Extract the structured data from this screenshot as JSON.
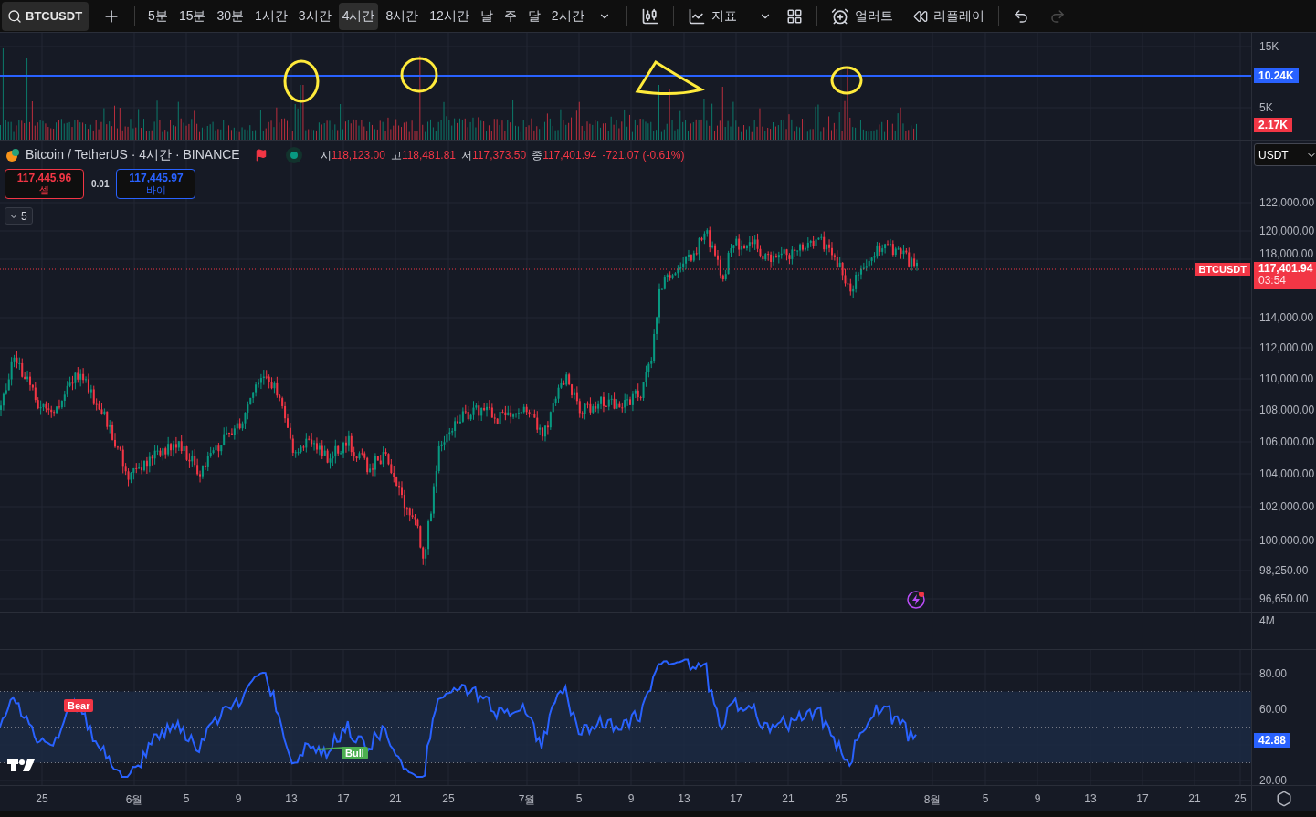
{
  "toolbar": {
    "symbol": "BTCUSDT",
    "intervals": [
      {
        "label": "5분",
        "selected": false
      },
      {
        "label": "15분",
        "selected": false
      },
      {
        "label": "30분",
        "selected": false
      },
      {
        "label": "1시간",
        "selected": false
      },
      {
        "label": "3시간",
        "selected": false
      },
      {
        "label": "4시간",
        "selected": true
      },
      {
        "label": "8시간",
        "selected": false
      },
      {
        "label": "12시간",
        "selected": false
      },
      {
        "label": "날",
        "selected": false
      },
      {
        "label": "주",
        "selected": false
      },
      {
        "label": "달",
        "selected": false
      },
      {
        "label": "2시간",
        "selected": false
      }
    ],
    "indicators_label": "지표",
    "alert_label": "얼러트",
    "replay_label": "리플레이",
    "redo_disabled": true
  },
  "volume_pane": {
    "axis": [
      "15K",
      "5K"
    ],
    "line_badge": "10.24K",
    "volume_badge": "2.17K"
  },
  "legend": {
    "title": "Bitcoin / TetherUS · 4시간 · BINANCE",
    "ohlc": [
      {
        "key": "시",
        "value": "118,123.00"
      },
      {
        "key": "고",
        "value": "118,481.81"
      },
      {
        "key": "저",
        "value": "117,373.50"
      },
      {
        "key": "종",
        "value": "117,401.94"
      }
    ],
    "change": "-721.07 (-0.61%)"
  },
  "trade": {
    "sell_price": "117,445.96",
    "sell_label": "셀",
    "spread": "0.01",
    "buy_price": "117,445.97",
    "buy_label": "바이"
  },
  "collapse_count": "5",
  "price_axis": {
    "currency": "USDT",
    "labels": [
      "122,000.00",
      "120,000.00",
      "118,000.00",
      "114,000.00",
      "112,000.00",
      "110,000.00",
      "108,000.00",
      "106,000.00",
      "104,000.00",
      "102,000.00",
      "100,000.00",
      "98,250.00",
      "96,650.00"
    ]
  },
  "last_price": {
    "symbol": "BTCUSDT",
    "price": "117,401.94",
    "countdown": "03:54"
  },
  "small_pane": {
    "axis": "4M"
  },
  "rsi": {
    "axis": [
      "80.00",
      "60.00",
      "20.00"
    ],
    "value": "42.88",
    "bear": "Bear",
    "bull": "Bull"
  },
  "time_axis": [
    "25",
    "6월",
    "5",
    "9",
    "13",
    "17",
    "21",
    "25",
    "7월",
    "5",
    "9",
    "13",
    "17",
    "21",
    "25",
    "8월",
    "5",
    "9",
    "13",
    "17",
    "21",
    "25"
  ]
}
